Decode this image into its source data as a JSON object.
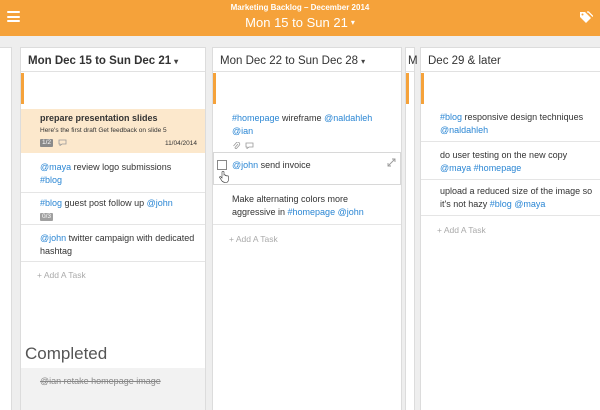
{
  "header": {
    "app_title": "Marketing Backlog – December 2014",
    "period": "Mon 15 to Sun 21",
    "period_caret": "▾"
  },
  "icons": {
    "menu": "menu-icon",
    "tags": "tags-icon"
  },
  "colors": {
    "accent": "#f5a23a",
    "tag_link": "#2a86d4",
    "highlight": "#fce8cc"
  },
  "columns": [
    {
      "title": "Mon Dec 15 to Sun Dec 21",
      "caret": "▾",
      "tasks": [
        {
          "title": "prepare presentation slides",
          "subtitle": "Here's the first draft Get feedback on slide 5",
          "badge": "1/2",
          "date": "11/04/2014"
        },
        {
          "mention": "@maya",
          "text": " review logo submissions ",
          "tag": "#blog"
        },
        {
          "tag": "#blog",
          "text": " guest post follow up ",
          "mention": "@john",
          "badge": "0/3"
        },
        {
          "mention": "@john",
          "text": " twitter campaign with dedicated hashtag"
        }
      ],
      "add_task": "+ Add A Task",
      "completed_title": "Completed",
      "completed": [
        {
          "mention": "@ian",
          "text": " retake homepage image"
        }
      ]
    },
    {
      "title": "Mon Dec 22 to Sun Dec 28",
      "caret": "▾",
      "tasks": [
        {
          "tag": "#homepage",
          "text": " wireframe ",
          "mention": "@naldahleh",
          "mention2": "@ian"
        },
        {
          "mention": "@john",
          "text": " send invoice"
        },
        {
          "text": "Make alternating colors more aggressive in ",
          "tag": "#homepage",
          "mention": "@john"
        }
      ],
      "add_task": "+ Add A Task"
    },
    {
      "title": "Dec 29 & later",
      "tasks": [
        {
          "tag": "#blog",
          "text": " responsive design techniques ",
          "mention": "@naldahleh"
        },
        {
          "text": "do user testing on the new copy ",
          "mention": "@maya",
          "tag": "#homepage"
        },
        {
          "text": "upload a reduced size of the image so it's not hazy ",
          "tag": "#blog",
          "mention": "@maya"
        }
      ],
      "add_task": "+ Add A Task"
    }
  ]
}
